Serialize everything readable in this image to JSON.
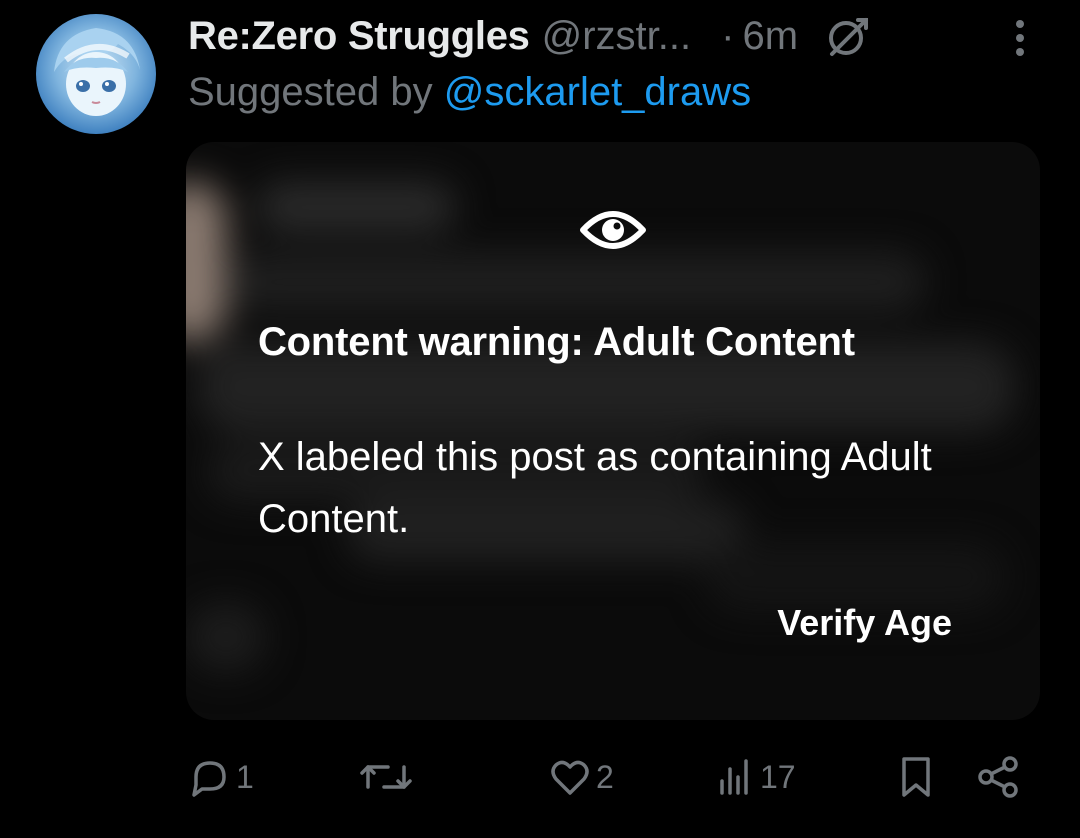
{
  "post": {
    "display_name": "Re:Zero Struggles",
    "handle": "@rzstr...",
    "separator": "·",
    "time": "6m",
    "suggested_prefix": "Suggested by",
    "suggested_by": "@sckarlet_draws",
    "icons": {
      "grok": "grok-icon",
      "more": "more-options-icon"
    }
  },
  "media": {
    "warning_icon": "eye-icon",
    "warning_title": "Content warning: Adult Content",
    "warning_body": "X labeled this post as containing Adult Content.",
    "verify_label": "Verify Age"
  },
  "actions": {
    "reply_count": "1",
    "repost_count": "",
    "like_count": "2",
    "views_count": "17",
    "icons": [
      "reply-icon",
      "repost-icon",
      "like-icon",
      "views-icon",
      "bookmark-icon",
      "share-icon"
    ]
  },
  "colors": {
    "background": "#000000",
    "primary_text": "#e7e9ea",
    "secondary_text": "#71767b",
    "link": "#1d9bf0"
  }
}
